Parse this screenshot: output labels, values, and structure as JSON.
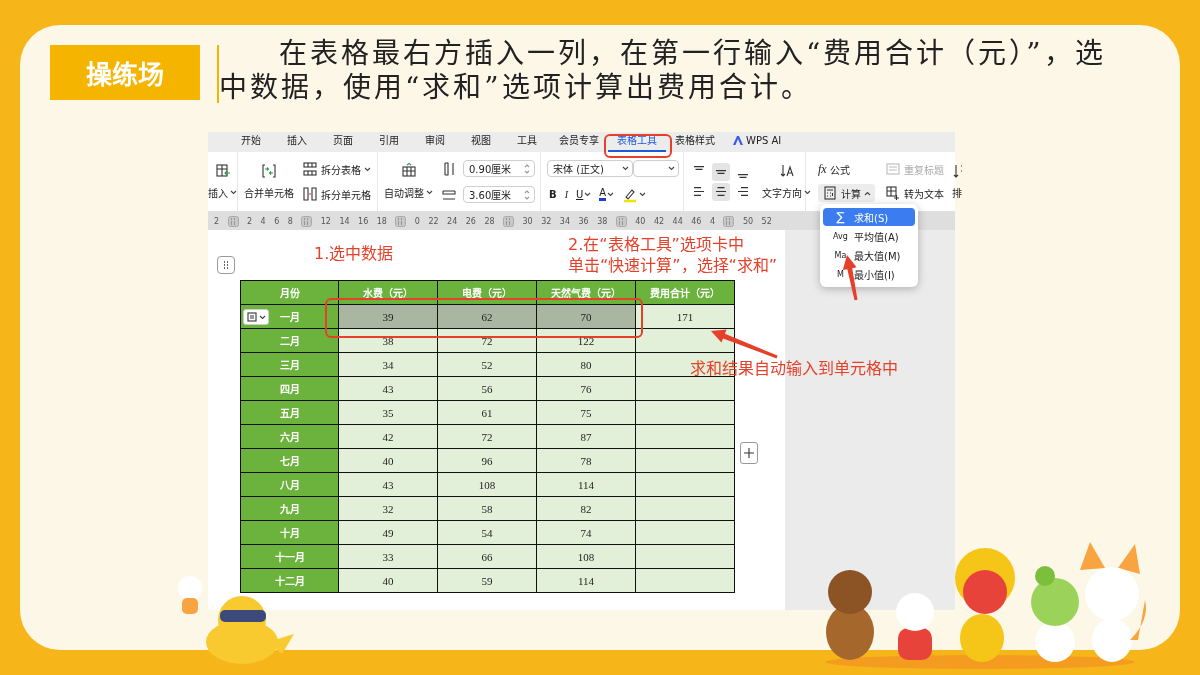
{
  "badge": "操练场",
  "instruction": "在表格最右方插入一列，在第一行输入“费用合计（元）”，选中数据，使用“求和”选项计算出费用合计。",
  "window": {
    "tabs": [
      {
        "label": "开始",
        "selected": false
      },
      {
        "label": "插入",
        "selected": false
      },
      {
        "label": "页面",
        "selected": false
      },
      {
        "label": "引用",
        "selected": false
      },
      {
        "label": "审阅",
        "selected": false
      },
      {
        "label": "视图",
        "selected": false
      },
      {
        "label": "工具",
        "selected": false
      },
      {
        "label": "会员专享",
        "selected": false
      },
      {
        "label": "表格工具",
        "selected": true
      },
      {
        "label": "表格样式",
        "selected": false
      },
      {
        "label": "WPS AI",
        "selected": false
      }
    ],
    "ribbon": {
      "insert": "插入",
      "merge": "合并单元格",
      "split_table": "拆分表格",
      "split_cells": "拆分单元格",
      "autofit": "自动调整",
      "width": "0.90厘米",
      "height": "3.60厘米",
      "font": "宋体 (正文)",
      "bold": "B",
      "italic": "I",
      "underline": "U",
      "font_color": "A",
      "align": [
        {
          "selected": false
        },
        {
          "selected": true
        },
        {
          "selected": false
        },
        {
          "selected": false
        },
        {
          "selected": true
        },
        {
          "selected": false
        }
      ],
      "text_direction": "文字方向",
      "formula_icon": "fx",
      "formula": "公式",
      "repeat_header": {
        "label": "重复标题",
        "disabled": true
      },
      "calculate": {
        "label": "计算",
        "expanded": true
      },
      "to_text": "转为文本",
      "sort": "排"
    },
    "ruler": [
      {
        "kind": "num",
        "label": "2"
      },
      {
        "kind": "marker"
      },
      {
        "kind": "num",
        "label": "2"
      },
      {
        "kind": "num",
        "label": "4"
      },
      {
        "kind": "num",
        "label": "6"
      },
      {
        "kind": "num",
        "label": "8"
      },
      {
        "kind": "marker"
      },
      {
        "kind": "num",
        "label": "12"
      },
      {
        "kind": "num",
        "label": "14"
      },
      {
        "kind": "num",
        "label": "16"
      },
      {
        "kind": "num",
        "label": "18"
      },
      {
        "kind": "marker"
      },
      {
        "kind": "num",
        "label": "0"
      },
      {
        "kind": "num",
        "label": "22"
      },
      {
        "kind": "num",
        "label": "24"
      },
      {
        "kind": "num",
        "label": "26"
      },
      {
        "kind": "num",
        "label": "28"
      },
      {
        "kind": "marker"
      },
      {
        "kind": "num",
        "label": "30"
      },
      {
        "kind": "num",
        "label": "32"
      },
      {
        "kind": "num",
        "label": "34"
      },
      {
        "kind": "num",
        "label": "36"
      },
      {
        "kind": "num",
        "label": "38"
      },
      {
        "kind": "marker"
      },
      {
        "kind": "num",
        "label": "40"
      },
      {
        "kind": "num",
        "label": "42"
      },
      {
        "kind": "num",
        "label": "44"
      },
      {
        "kind": "num",
        "label": "46"
      },
      {
        "kind": "num",
        "label": "4"
      },
      {
        "kind": "marker"
      },
      {
        "kind": "num",
        "label": "50"
      },
      {
        "kind": "num",
        "label": "52"
      }
    ],
    "calc_menu": {
      "items": [
        {
          "icon_text": "∑",
          "label": "求和(S)",
          "selected": true
        },
        {
          "icon_text": "Avg",
          "label": "平均值(A)",
          "selected": false
        },
        {
          "icon_text": "Ma",
          "label": "最大值(M)",
          "selected": false
        },
        {
          "icon_text": "M",
          "label": "最小值(I)",
          "selected": false
        }
      ]
    },
    "table": {
      "columns": [
        "月份",
        "水费（元）",
        "电费（元）",
        "天然气费（元）",
        "费用合计（元）"
      ],
      "rows": [
        {
          "cells": [
            {
              "text": "一月",
              "selected": false
            },
            {
              "text": "39",
              "selected": true
            },
            {
              "text": "62",
              "selected": true
            },
            {
              "text": "70",
              "selected": true
            },
            {
              "text": "171",
              "selected": false
            }
          ]
        },
        {
          "cells": [
            {
              "text": "二月",
              "selected": false
            },
            {
              "text": "38",
              "selected": false
            },
            {
              "text": "72",
              "selected": false
            },
            {
              "text": "122",
              "selected": false
            }
          ]
        },
        {
          "cells": [
            {
              "text": "三月",
              "selected": false
            },
            {
              "text": "34",
              "selected": false
            },
            {
              "text": "52",
              "selected": false
            },
            {
              "text": "80",
              "selected": false
            }
          ]
        },
        {
          "cells": [
            {
              "text": "四月",
              "selected": false
            },
            {
              "text": "43",
              "selected": false
            },
            {
              "text": "56",
              "selected": false
            },
            {
              "text": "76",
              "selected": false
            }
          ]
        },
        {
          "cells": [
            {
              "text": "五月",
              "selected": false
            },
            {
              "text": "35",
              "selected": false
            },
            {
              "text": "61",
              "selected": false
            },
            {
              "text": "75",
              "selected": false
            }
          ]
        },
        {
          "cells": [
            {
              "text": "六月",
              "selected": false
            },
            {
              "text": "42",
              "selected": false
            },
            {
              "text": "72",
              "selected": false
            },
            {
              "text": "87",
              "selected": false
            }
          ]
        },
        {
          "cells": [
            {
              "text": "七月",
              "selected": false
            },
            {
              "text": "40",
              "selected": false
            },
            {
              "text": "96",
              "selected": false
            },
            {
              "text": "78",
              "selected": false
            }
          ]
        },
        {
          "cells": [
            {
              "text": "八月",
              "selected": false
            },
            {
              "text": "43",
              "selected": false
            },
            {
              "text": "108",
              "selected": false
            },
            {
              "text": "114",
              "selected": false
            }
          ]
        },
        {
          "cells": [
            {
              "text": "九月",
              "selected": false
            },
            {
              "text": "32",
              "selected": false
            },
            {
              "text": "58",
              "selected": false
            },
            {
              "text": "82",
              "selected": false
            }
          ]
        },
        {
          "cells": [
            {
              "text": "十月",
              "selected": false
            },
            {
              "text": "49",
              "selected": false
            },
            {
              "text": "54",
              "selected": false
            },
            {
              "text": "74",
              "selected": false
            }
          ]
        },
        {
          "cells": [
            {
              "text": "十一月",
              "selected": false
            },
            {
              "text": "33",
              "selected": false
            },
            {
              "text": "66",
              "selected": false
            },
            {
              "text": "108",
              "selected": false
            }
          ]
        },
        {
          "cells": [
            {
              "text": "十二月",
              "selected": false
            },
            {
              "text": "40",
              "selected": false
            },
            {
              "text": "59",
              "selected": false
            },
            {
              "text": "114",
              "selected": false
            }
          ]
        }
      ]
    }
  },
  "annotations": {
    "step1": "1.选中数据",
    "step2": [
      "2.在“表格工具”选项卡中",
      "单击“快速计算”，选择“求和”"
    ],
    "result_note": "求和结果自动输入到单元格中"
  }
}
